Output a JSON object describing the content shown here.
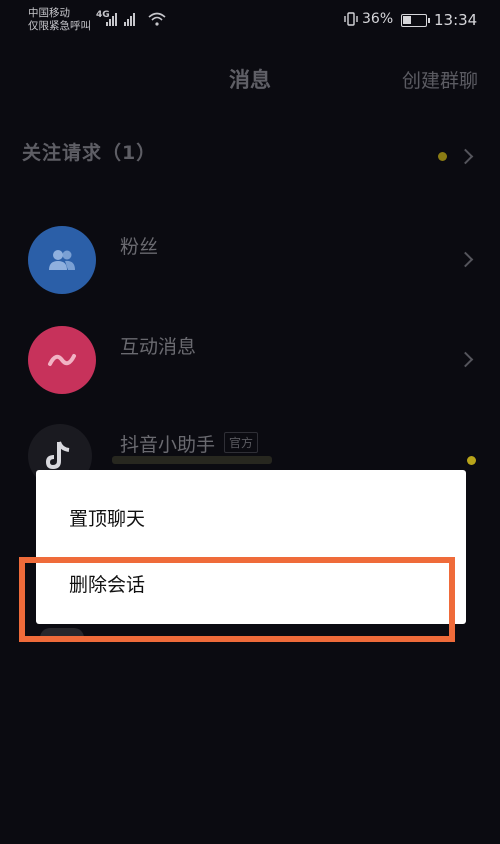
{
  "status_bar": {
    "carrier": "中国移动",
    "emergency": "仅限紧急呼叫",
    "network": "4G",
    "battery_percent": "36%",
    "battery_level": 0.36,
    "time": "13:34"
  },
  "header": {
    "title": "消息",
    "create_group": "创建群聊"
  },
  "follow_requests": {
    "label": "关注请求（1）"
  },
  "rows": [
    {
      "label": "粉丝",
      "icon": "fans-icon",
      "color": "#2b5fa8"
    },
    {
      "label": "互动消息",
      "icon": "interaction-icon",
      "color": "#c7325b"
    },
    {
      "label": "抖音小助手",
      "badge": "官方",
      "icon": "douyin-icon",
      "color": "#1a1a20"
    }
  ],
  "context_menu": {
    "items": [
      "置顶聊天",
      "删除会话"
    ]
  },
  "colors": {
    "background": "#0b0b11",
    "highlight": "#ef6b3a",
    "unread_dot": "#b8a41a"
  }
}
